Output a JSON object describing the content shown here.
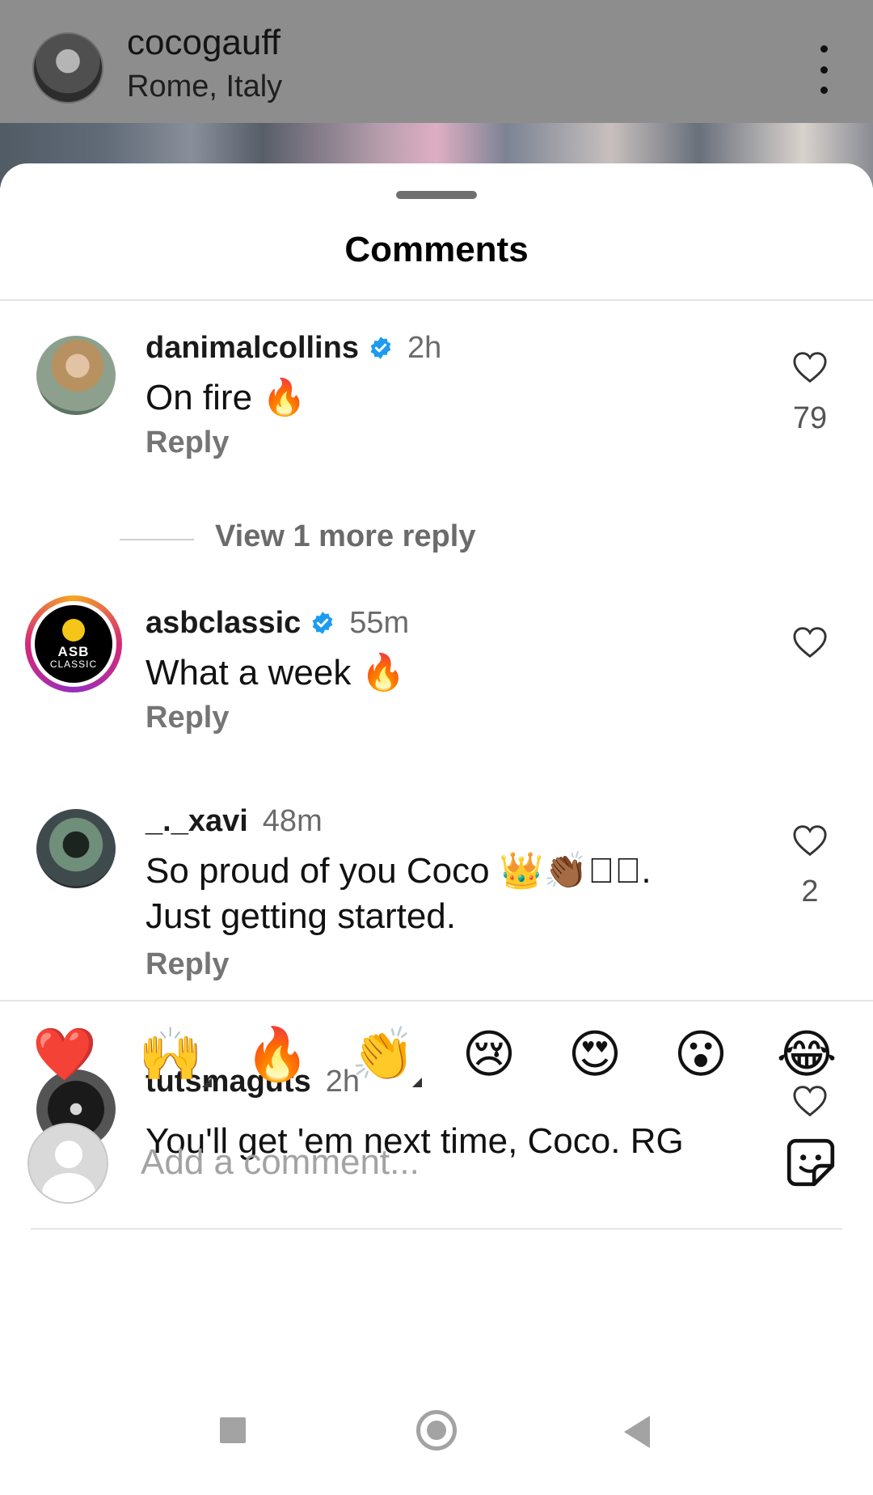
{
  "post": {
    "username": "cocogauff",
    "location": "Rome, Italy"
  },
  "sheet": {
    "title": "Comments"
  },
  "comments": [
    {
      "username": "danimalcollins",
      "verified": true,
      "time": "2h",
      "text": "On fire 🔥",
      "reply_label": "Reply",
      "likes": "79",
      "view_more_replies": "View 1 more reply"
    },
    {
      "username": "asbclassic",
      "verified": true,
      "time": "55m",
      "text": "What a week 🔥",
      "reply_label": "Reply",
      "likes": "",
      "avatar_text": "ASB",
      "avatar_subtext": "CLASSIC"
    },
    {
      "username": "_._xavi",
      "verified": false,
      "time": "48m",
      "text": "So proud of you Coco 👑👏🏾▯🏽. Just getting started.",
      "reply_label": "Reply",
      "likes": "2"
    },
    {
      "username": "tutsmaguts",
      "verified": false,
      "time": "2h",
      "text": "You'll get 'em next time, Coco. RG",
      "likes": ""
    }
  ],
  "reactions": [
    "❤️",
    "🙌",
    "🔥",
    "👏",
    "😢",
    "😍",
    "😮",
    "😂"
  ],
  "composer": {
    "placeholder": "Add a comment..."
  },
  "icons": {
    "verified": "verified-badge-icon",
    "like": "heart-outline-icon",
    "sticker": "sticker-icon",
    "more": "more-vertical-icon"
  },
  "colors": {
    "verified_blue": "#1d9bf0",
    "link_gray": "#757575"
  }
}
